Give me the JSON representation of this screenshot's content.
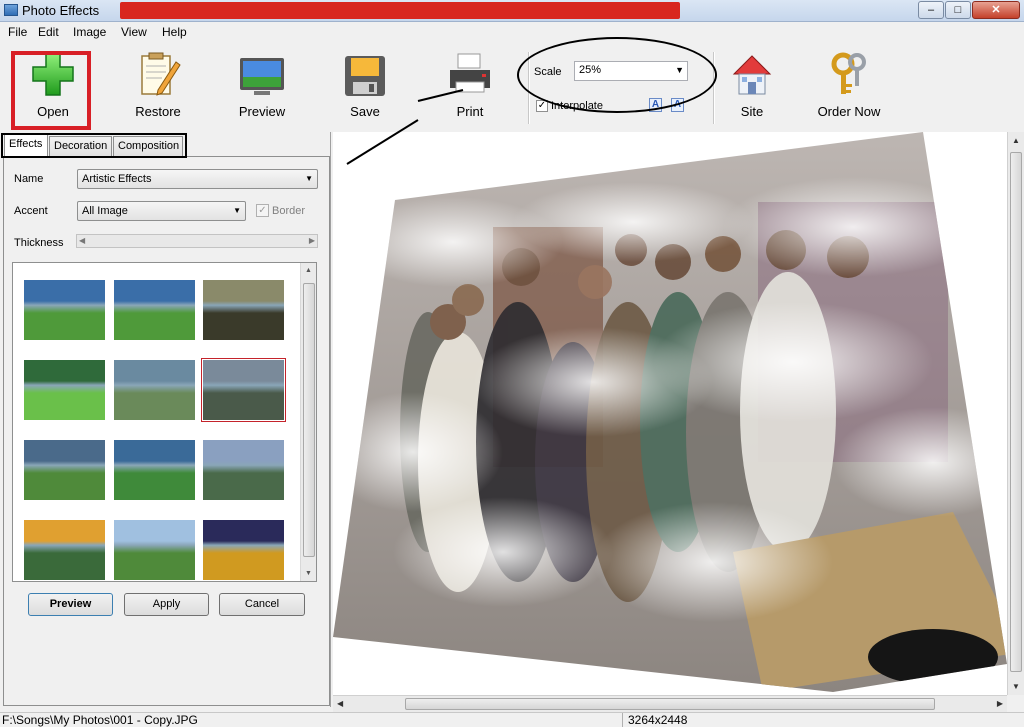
{
  "window": {
    "title": "Photo Effects",
    "min": "‒",
    "max": "□",
    "close": "✕"
  },
  "menu": [
    "File",
    "Edit",
    "Image",
    "View",
    "Help"
  ],
  "toolbar": {
    "open": "Open",
    "restore": "Restore",
    "preview": "Preview",
    "save": "Save",
    "print": "Print",
    "scale_label": "Scale",
    "scale_value": "25%",
    "interpolate_label": "Interpolate",
    "interpolate_checked": true,
    "site": "Site",
    "order": "Order Now"
  },
  "tabs": [
    "Effects",
    "Decoration",
    "Composition"
  ],
  "effects": {
    "name_label": "Name",
    "name_value": "Artistic Effects",
    "accent_label": "Accent",
    "accent_value": "All Image",
    "border_label": "Border",
    "border_checked": true,
    "thickness_label": "Thickness",
    "selected_thumb_index": 5,
    "buttons": {
      "preview": "Preview",
      "apply": "Apply",
      "cancel": "Cancel"
    }
  },
  "status": {
    "path": "F:\\Songs\\My Photos\\001 - Copy.JPG",
    "dimensions": "3264x2448"
  },
  "colors": {
    "highlight_red": "#d81f26",
    "title_redaction": "#d8261f"
  }
}
